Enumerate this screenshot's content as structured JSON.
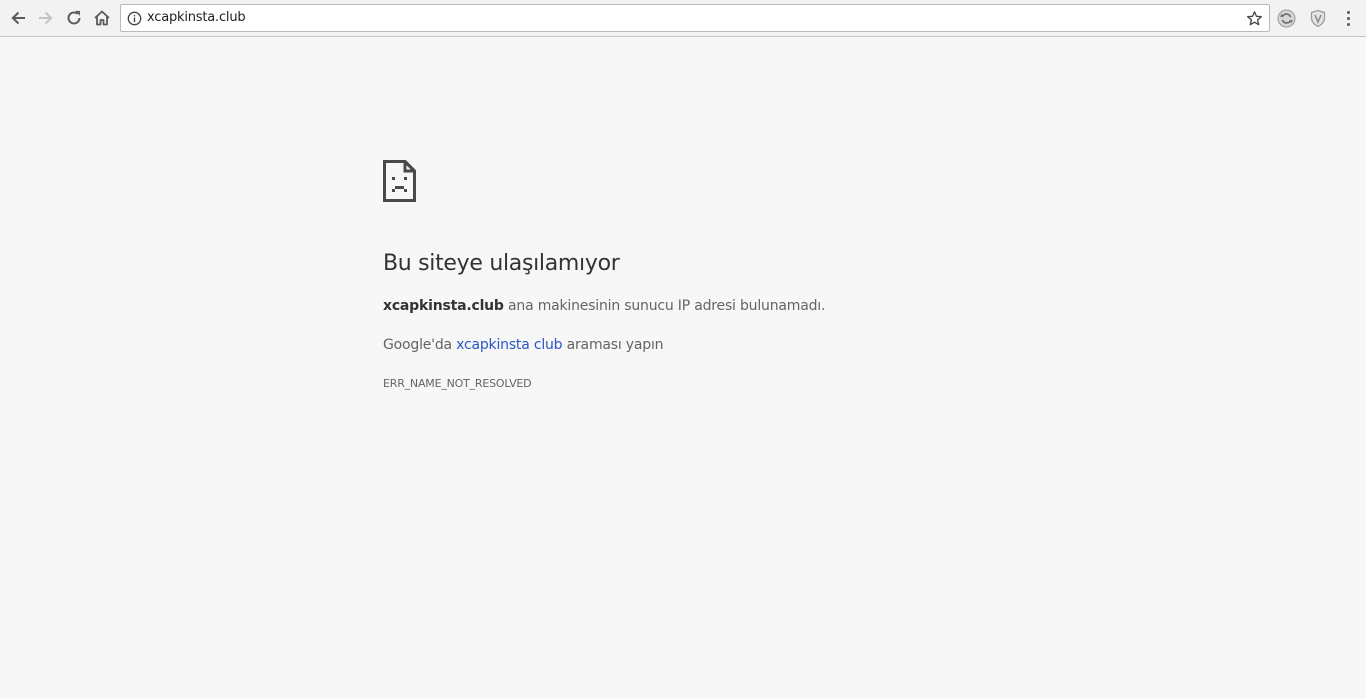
{
  "browser": {
    "url": "xcapkinsta.club",
    "icons": {
      "back": "arrow-left-icon",
      "forward": "arrow-right-icon",
      "reload": "reload-icon",
      "home": "home-icon",
      "info": "info-icon",
      "bookmark": "star-icon",
      "extension_1": "extension-refresh-icon",
      "extension_2": "shield-icon",
      "menu": "kebab-menu-icon"
    },
    "colors": {
      "toolbar": "#f2f2f2",
      "page_background": "#f7f7f7"
    }
  },
  "error_page": {
    "icon": "sad-document-icon",
    "title": "Bu siteye ulaşılamıyor",
    "host": "xcapkinsta.club",
    "host_message": " ana makinesinin sunucu IP adresi bulunamadı.",
    "search_prefix": "Google'da ",
    "search_link": "xcapkinsta club",
    "search_suffix": " araması yapın",
    "error_code": "ERR_NAME_NOT_RESOLVED",
    "colors": {
      "title": "#333333",
      "text": "#646464",
      "link": "#2a56c6"
    }
  }
}
